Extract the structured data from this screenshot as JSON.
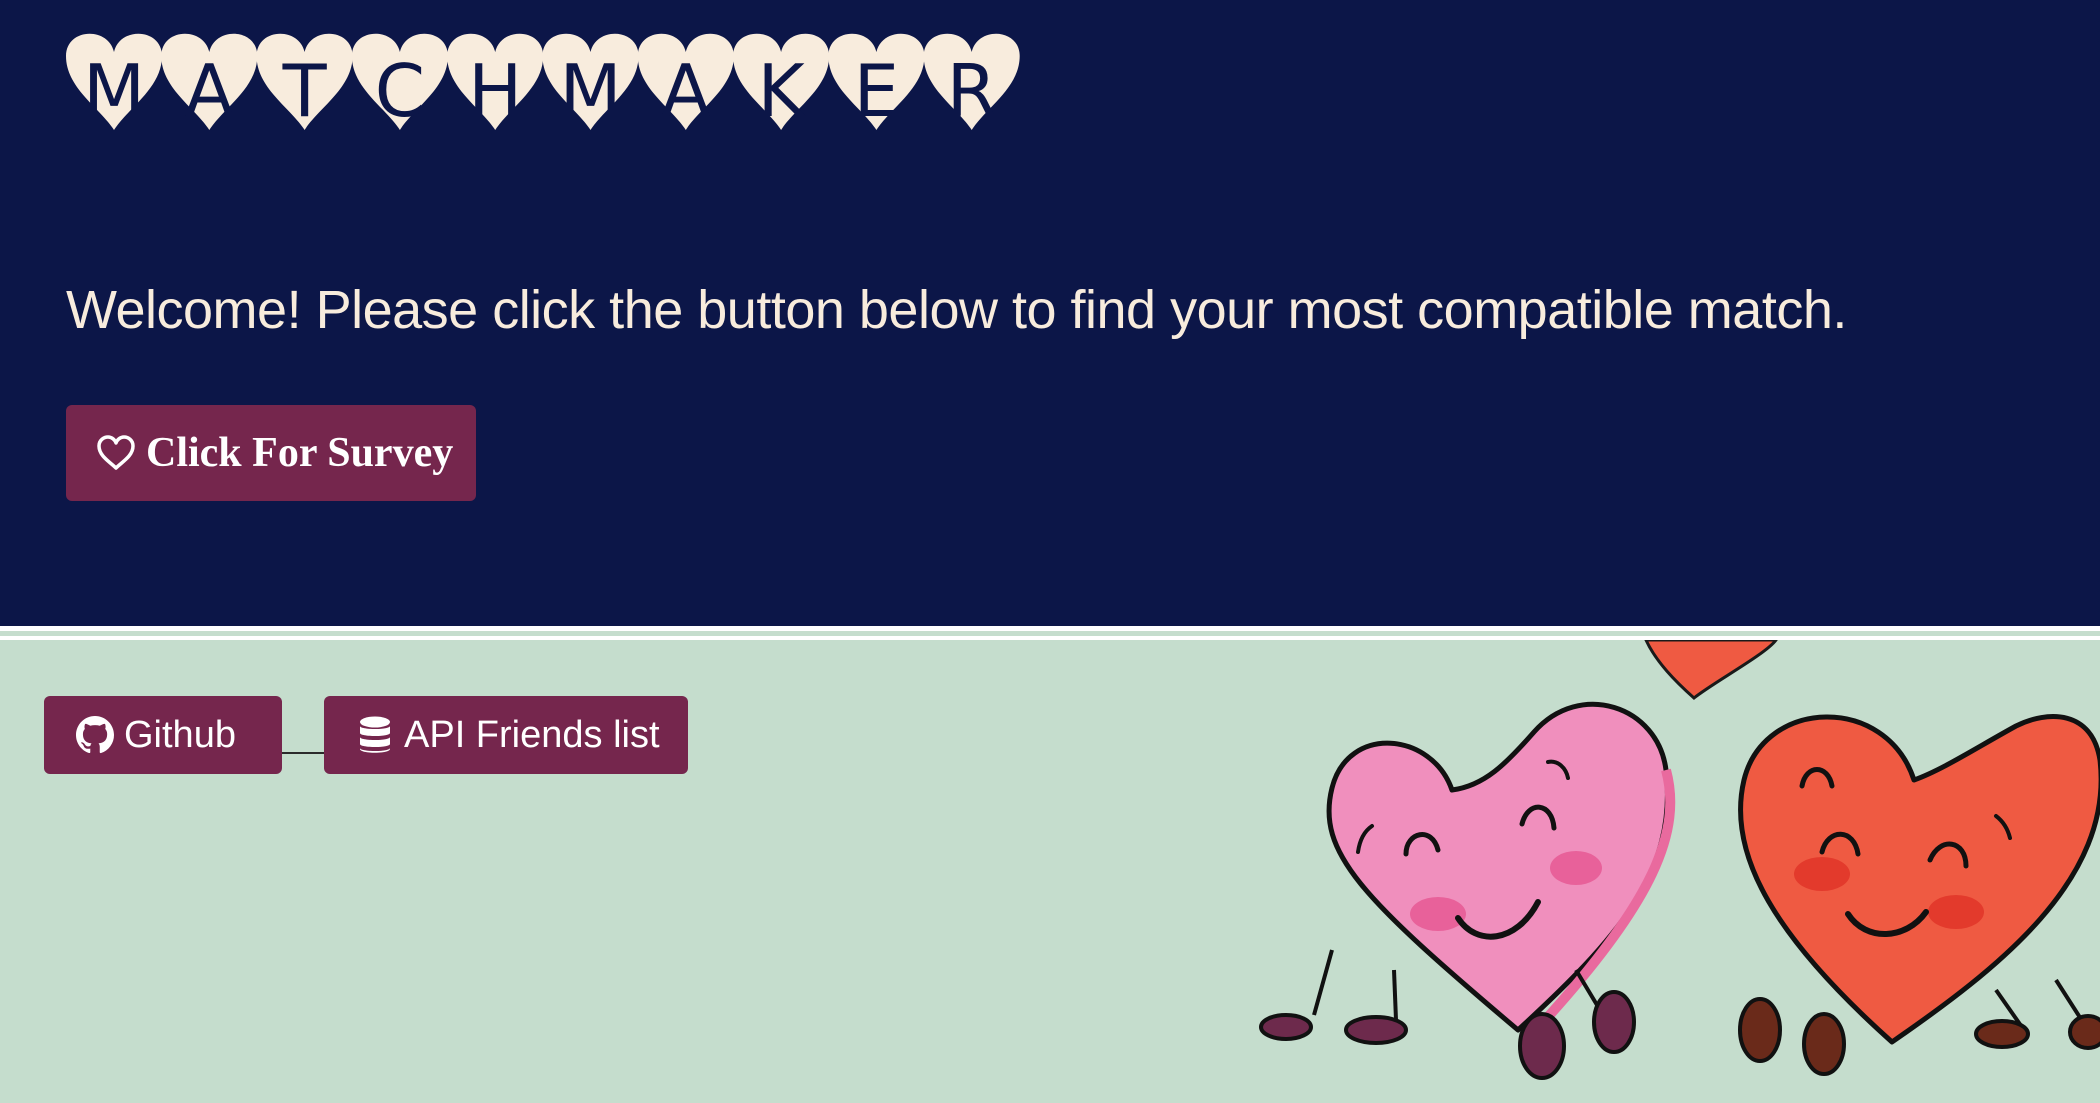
{
  "header": {
    "logo_text": "MATCHMAKER",
    "logo_letters": [
      "M",
      "A",
      "T",
      "C",
      "H",
      "M",
      "A",
      "K",
      "E",
      "R"
    ],
    "welcome_text": "Welcome! Please click the button below to find your most compatible match.",
    "survey_button": {
      "icon": "heart-outline-icon",
      "label": "Click For Survey"
    }
  },
  "footer": {
    "github_button": {
      "icon": "github-icon",
      "label": "Github"
    },
    "api_button": {
      "icon": "database-icon",
      "label": "API Friends list"
    },
    "illustration": "two-cartoon-hearts"
  },
  "colors": {
    "hero_background": "#0c1648",
    "footer_background": "#c5ddcd",
    "button_background": "#75264d",
    "logo_heart": "#f8ecdd",
    "text_light": "#f8ecdd",
    "pink_heart": "#f08fbd",
    "red_heart": "#ef5a42"
  }
}
